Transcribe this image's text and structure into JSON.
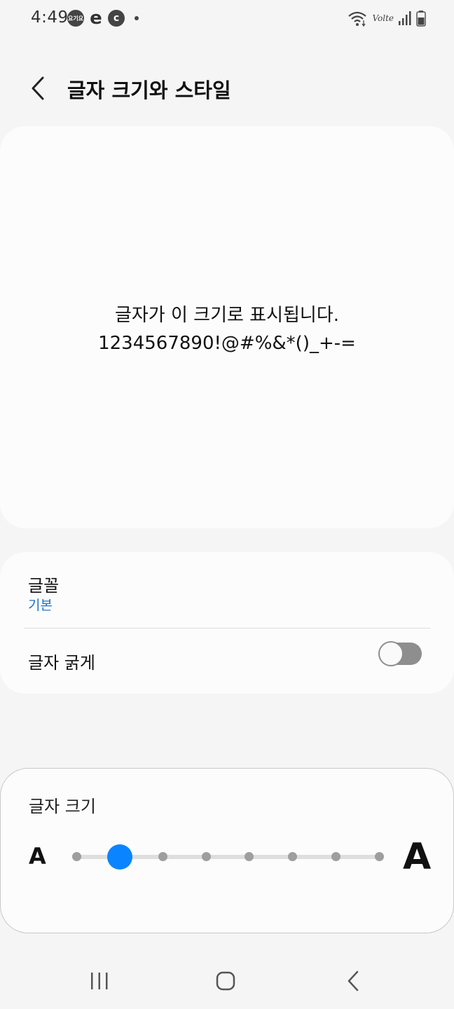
{
  "status_bar": {
    "time": "4:49",
    "notification_badge_text": "요기요",
    "notification_e": "e",
    "notification_c": "c",
    "volte_label": "Volte"
  },
  "header": {
    "title": "글자 크기와 스타일"
  },
  "preview": {
    "line1": "글자가 이 크기로 표시됩니다.",
    "line2": "1234567890!@#%&*()_+-="
  },
  "settings": {
    "font": {
      "title": "글꼴",
      "value": "기본"
    },
    "bold": {
      "title": "글자 굵게",
      "enabled": false
    }
  },
  "font_size": {
    "title": "글자 크기",
    "small_label": "A",
    "large_label": "A",
    "steps": 8,
    "selected_step": 2
  },
  "colors": {
    "accent": "#0a84ff",
    "link": "#1a73c8",
    "background": "#f5f5f5",
    "card": "#fcfcfc"
  },
  "icons": {
    "back": "chevron-left-icon",
    "recents": "recents-icon",
    "home": "home-icon",
    "nav_back": "nav-back-icon",
    "wifi": "wifi-icon",
    "signal": "signal-icon",
    "battery": "battery-icon"
  }
}
